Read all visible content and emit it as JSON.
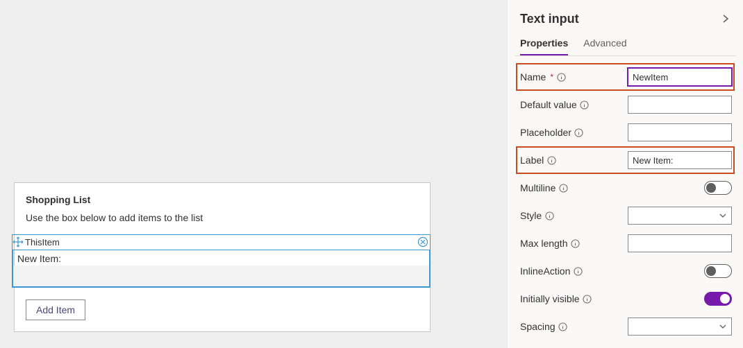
{
  "panel": {
    "title": "Text input",
    "tabs": {
      "properties": "Properties",
      "advanced": "Advanced"
    },
    "props": {
      "name_label": "Name",
      "name_value": "NewItem",
      "default_label": "Default value",
      "default_value": "",
      "placeholder_label": "Placeholder",
      "placeholder_value": "",
      "label_label": "Label",
      "label_value": "New Item:",
      "multiline_label": "Multiline",
      "style_label": "Style",
      "maxlength_label": "Max length",
      "maxlength_value": "",
      "inlineaction_label": "InlineAction",
      "initvisible_label": "Initially visible",
      "spacing_label": "Spacing"
    }
  },
  "canvas": {
    "card_title": "Shopping List",
    "card_sub": "Use the box below to add items to the list",
    "selection_name": "ThisItem",
    "field_label": "New Item:",
    "add_button": "Add Item"
  }
}
